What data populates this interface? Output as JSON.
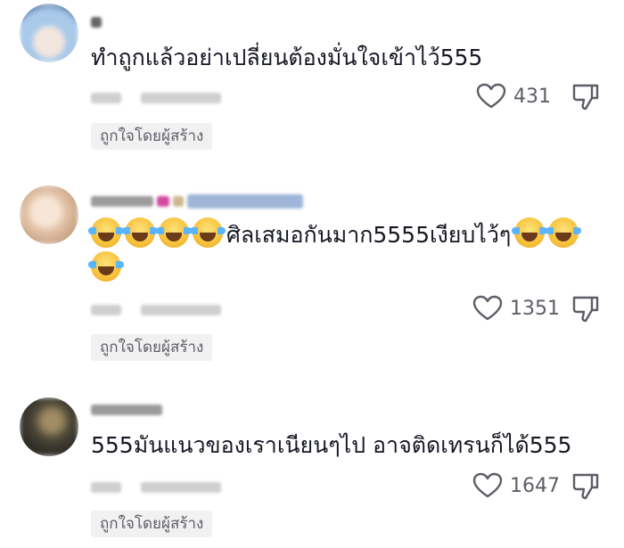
{
  "comments": [
    {
      "text": "ทำถูกแล้วอย่าเปลี่ยนต้องมั่นใจเข้าไว้555",
      "likes": "431",
      "liked_by_creator": "ถูกใจโดยผู้สร้าง",
      "avatar_colors": [
        "#9fc3e6",
        "#e8ddd6"
      ]
    },
    {
      "emoji_prefix_count": 4,
      "text": "ศิลเสมอกันมาก5555เงียบไว้ๆ",
      "emoji_suffix_count": 3,
      "likes": "1351",
      "liked_by_creator": "ถูกใจโดยผู้สร้าง",
      "avatar_colors": [
        "#f0d9c8",
        "#d8b79d"
      ]
    },
    {
      "text": "555มันแนวของเราเนียนๆไป อาจติดเทรนก็ได้555",
      "likes": "1647",
      "liked_by_creator": "ถูกใจโดยผู้สร้าง",
      "avatar_colors": [
        "#3a3a32",
        "#8d7a55"
      ]
    }
  ],
  "icons": {
    "like": "heart-outline-icon",
    "dislike": "thumbs-down-outline-icon",
    "emoji": "tears-of-joy-emoji"
  },
  "colors": {
    "text": "#161823",
    "muted": "#5c5e66",
    "chip_bg": "#f1f1f2"
  }
}
